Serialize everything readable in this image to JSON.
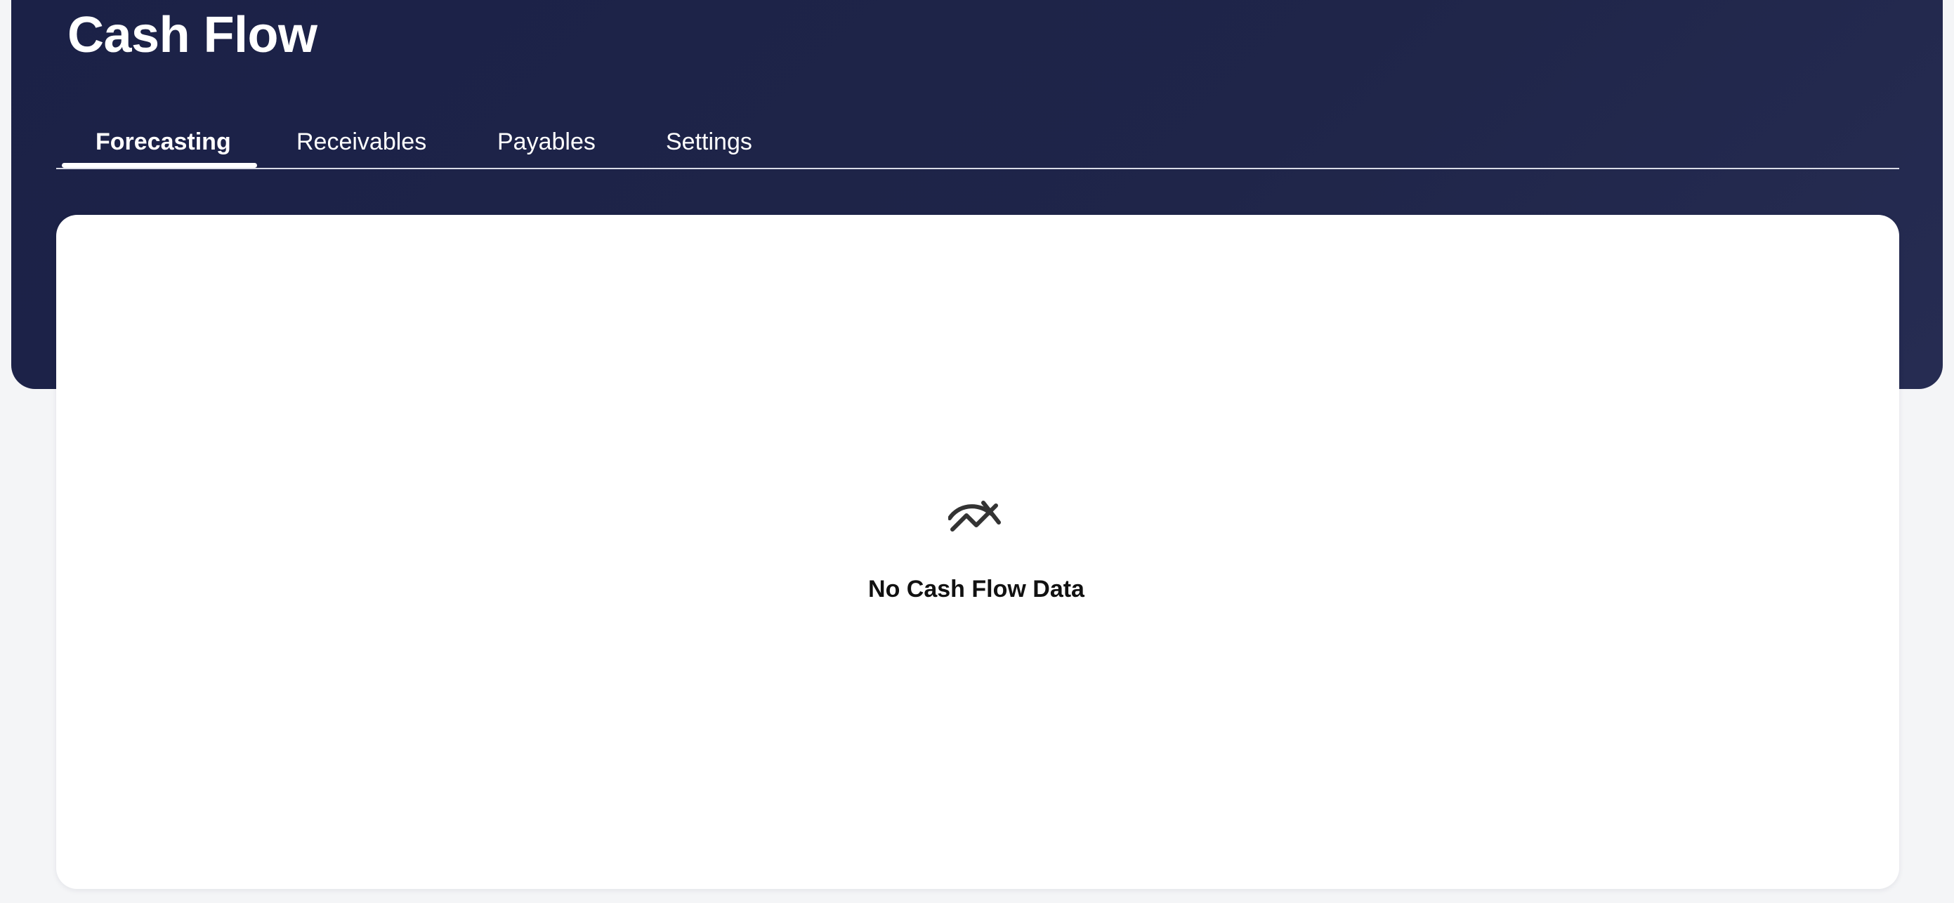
{
  "header": {
    "title": "Cash Flow"
  },
  "tabs": [
    {
      "label": "Forecasting",
      "active": true
    },
    {
      "label": "Receivables",
      "active": false
    },
    {
      "label": "Payables",
      "active": false
    },
    {
      "label": "Settings",
      "active": false
    }
  ],
  "empty_state": {
    "icon": "chart-off-icon",
    "message": "No Cash Flow Data"
  },
  "colors": {
    "header_background": "#1f2549",
    "page_background": "#f4f5f7",
    "card_background": "#ffffff"
  }
}
